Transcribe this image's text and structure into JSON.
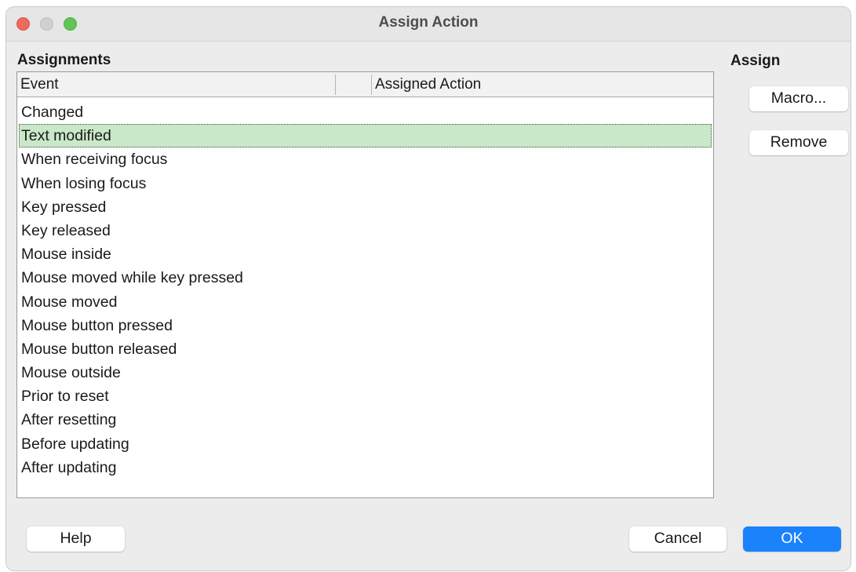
{
  "window": {
    "title": "Assign Action"
  },
  "assignments": {
    "label": "Assignments",
    "columns": {
      "event": "Event",
      "assigned_action": "Assigned Action"
    },
    "events": [
      "Changed",
      "Text modified",
      "When receiving focus",
      "When losing focus",
      "Key pressed",
      "Key released",
      "Mouse inside",
      "Mouse moved while key pressed",
      "Mouse moved",
      "Mouse button pressed",
      "Mouse button released",
      "Mouse outside",
      "Prior to reset",
      "After resetting",
      "Before updating",
      "After updating"
    ],
    "selected_event": "Text modified"
  },
  "assign": {
    "label": "Assign",
    "macro_button": "Macro...",
    "remove_button": "Remove"
  },
  "footer": {
    "help_button": "Help",
    "cancel_button": "Cancel",
    "ok_button": "OK"
  },
  "colors": {
    "selection_highlight": "#c9e8c7",
    "default_button": "#1a82fb",
    "close_light": "#ed6a5e",
    "zoom_light": "#61c554",
    "minimize_light_inactive": "#d0d0d0"
  }
}
